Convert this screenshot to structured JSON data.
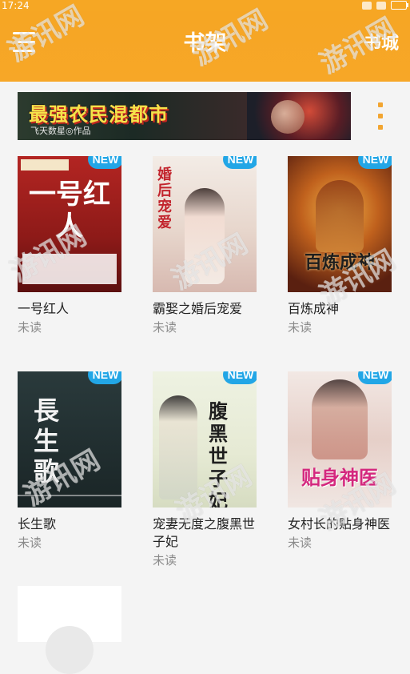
{
  "status_bar": {
    "time": "17:24"
  },
  "header": {
    "title": "书架",
    "store_label": "书城"
  },
  "banner": {
    "title": "最强农民混都市",
    "subtitle": "飞天数星◎作品"
  },
  "books": [
    {
      "title": "一号红人",
      "status": "未读",
      "badge": "NEW",
      "cover_text": "一号红人",
      "cover_color": "#a51f1d"
    },
    {
      "title": "霸娶之婚后宠爱",
      "status": "未读",
      "badge": "NEW",
      "cover_text": "婚后宠爱",
      "cover_color": "#e8d6cf"
    },
    {
      "title": "百炼成神",
      "status": "未读",
      "badge": "NEW",
      "cover_text": "百炼成神",
      "cover_color": "#b5561b"
    },
    {
      "title": "长生歌",
      "status": "未读",
      "badge": "NEW",
      "cover_text": "長生歌",
      "cover_color": "#1e2c2e"
    },
    {
      "title": "宠妻无度之腹黑世子妃",
      "status": "未读",
      "badge": "NEW",
      "cover_text": "腹黑世子妃",
      "cover_color": "#e9eedc"
    },
    {
      "title": "女村长的贴身神医",
      "status": "未读",
      "badge": "NEW",
      "cover_text": "贴身神医",
      "cover_color": "#e8d9d2"
    }
  ],
  "watermark": "游讯网",
  "colors": {
    "accent": "#f6a624",
    "badge": "#22a6e6"
  }
}
